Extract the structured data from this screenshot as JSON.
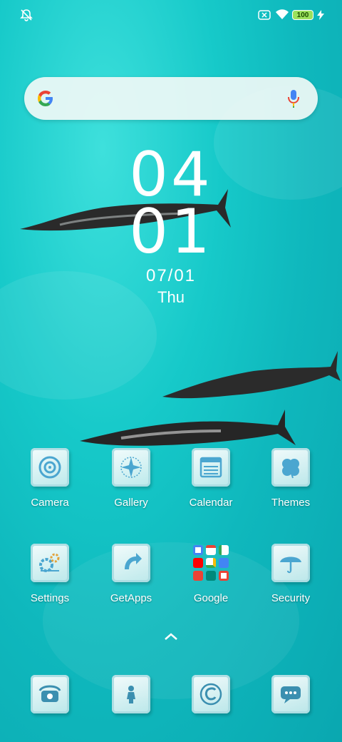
{
  "status_bar": {
    "battery_level": "100",
    "icons": [
      "notifications-off-icon",
      "sim-no-signal-icon",
      "wifi-icon",
      "charging-icon"
    ]
  },
  "clock": {
    "hours": "04",
    "minutes": "01"
  },
  "date": {
    "date": "07/01",
    "day": "Thu"
  },
  "apps_row1": [
    {
      "label": "Camera",
      "icon": "camera-icon"
    },
    {
      "label": "Gallery",
      "icon": "gallery-icon"
    },
    {
      "label": "Calendar",
      "icon": "calendar-icon"
    },
    {
      "label": "Themes",
      "icon": "themes-icon"
    }
  ],
  "apps_row2": [
    {
      "label": "Settings",
      "icon": "settings-icon"
    },
    {
      "label": "GetApps",
      "icon": "getapps-icon"
    },
    {
      "label": "Google",
      "icon": "google-folder-icon"
    },
    {
      "label": "Security",
      "icon": "security-icon"
    }
  ],
  "dock": [
    {
      "icon": "phone-icon"
    },
    {
      "icon": "contacts-icon"
    },
    {
      "icon": "browser-icon"
    },
    {
      "icon": "messages-icon"
    }
  ]
}
